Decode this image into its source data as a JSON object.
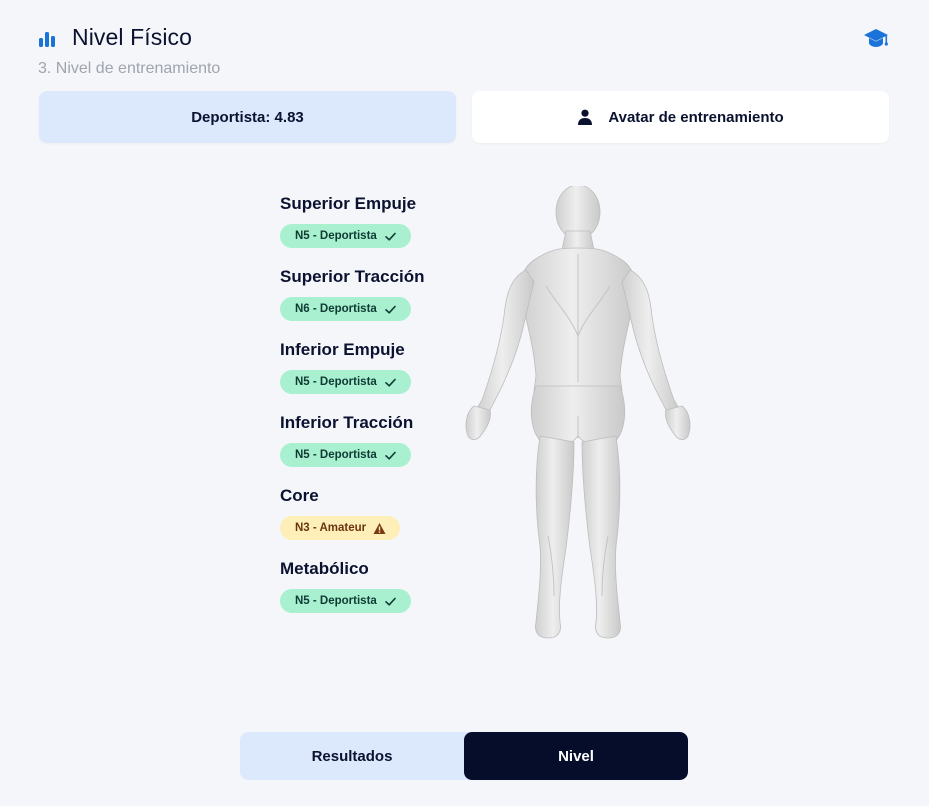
{
  "header": {
    "title": "Nivel Físico",
    "icon": "bar-chart-icon",
    "right_icon": "graduation-cap-icon"
  },
  "subtitle": "3. Nivel de entrenamiento",
  "score_card": {
    "label": "Deportista: 4.83"
  },
  "avatar_card": {
    "label": "Avatar de entrenamiento",
    "icon": "person-icon"
  },
  "levels": [
    {
      "name": "Superior Empuje",
      "badge": "N5 - Deportista",
      "status": "ok"
    },
    {
      "name": "Superior Tracción",
      "badge": "N6 - Deportista",
      "status": "ok"
    },
    {
      "name": "Inferior Empuje",
      "badge": "N5 - Deportista",
      "status": "ok"
    },
    {
      "name": "Inferior Tracción",
      "badge": "N5 - Deportista",
      "status": "ok"
    },
    {
      "name": "Core",
      "badge": "N3 - Amateur",
      "status": "warn"
    },
    {
      "name": "Metabólico",
      "badge": "N5 - Deportista",
      "status": "ok"
    }
  ],
  "tabs": {
    "results": "Resultados",
    "level": "Nivel",
    "active": "level"
  },
  "colors": {
    "accent": "#1a73d9",
    "dark": "#060d2b",
    "badge_ok": "#a8f0cf",
    "badge_warn": "#fdefb7",
    "card_blue": "#dce9fc"
  }
}
